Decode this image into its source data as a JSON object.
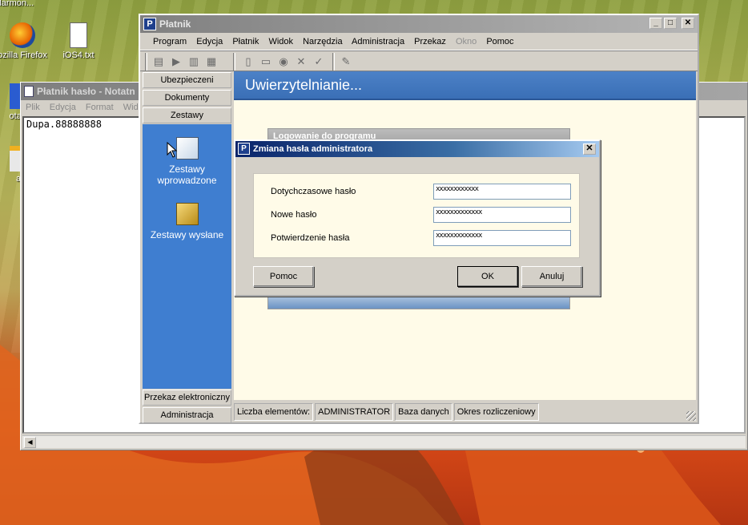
{
  "desktop": {
    "icons": [
      {
        "label": "Harmon...",
        "icon": "harmony-icon"
      },
      {
        "label": "ozilla Firefox",
        "icon": "firefox-icon"
      },
      {
        "label": "iOS4.txt",
        "icon": "text-file-icon"
      },
      {
        "label": "otalM",
        "icon": "total-commander-icon"
      },
      {
        "label": "agr",
        "icon": "pdf-icon"
      }
    ]
  },
  "notepad": {
    "title": "Płatnik hasło - Notatn",
    "menu": [
      "Plik",
      "Edycja",
      "Format",
      "Widok"
    ],
    "content": "Dupa.88888888"
  },
  "platnik": {
    "title": "Płatnik",
    "menu": [
      {
        "label": "Program",
        "disabled": false
      },
      {
        "label": "Edycja",
        "disabled": false
      },
      {
        "label": "Płatnik",
        "disabled": false
      },
      {
        "label": "Widok",
        "disabled": false
      },
      {
        "label": "Narzędzia",
        "disabled": false
      },
      {
        "label": "Administracja",
        "disabled": false
      },
      {
        "label": "Przekaz",
        "disabled": false
      },
      {
        "label": "Okno",
        "disabled": true
      },
      {
        "label": "Pomoc",
        "disabled": false
      }
    ],
    "sidebar": {
      "top_buttons": [
        "Ubezpieczeni",
        "Dokumenty",
        "Zestawy"
      ],
      "items": [
        "Zestawy wprowadzone",
        "Zestawy wysłane"
      ],
      "bottom_buttons": [
        "Przekaz elektroniczny",
        "Administracja"
      ]
    },
    "content": {
      "header": "Uwierzytelnianie...",
      "login_box_title": "Logowanie do programu"
    },
    "status": [
      "Liczba elementów:",
      "ADMINISTRATOR",
      "Baza danych",
      "Okres rozliczeniowy"
    ]
  },
  "dialog": {
    "title": "Zmiana hasła administratora",
    "fields": [
      {
        "label": "Dotychczasowe hasło",
        "value": "xxxxxxxxxxxx"
      },
      {
        "label": "Nowe hasło",
        "value": "xxxxxxxxxxxxx"
      },
      {
        "label": "Potwierdzenie hasła",
        "value": "xxxxxxxxxxxxx"
      }
    ],
    "buttons": {
      "help": "Pomoc",
      "ok": "OK",
      "cancel": "Anuluj"
    }
  },
  "colors": {
    "accent": "#3f7ed0",
    "dialog_title": "#0a246a",
    "content_bg": "#fffbe8"
  }
}
